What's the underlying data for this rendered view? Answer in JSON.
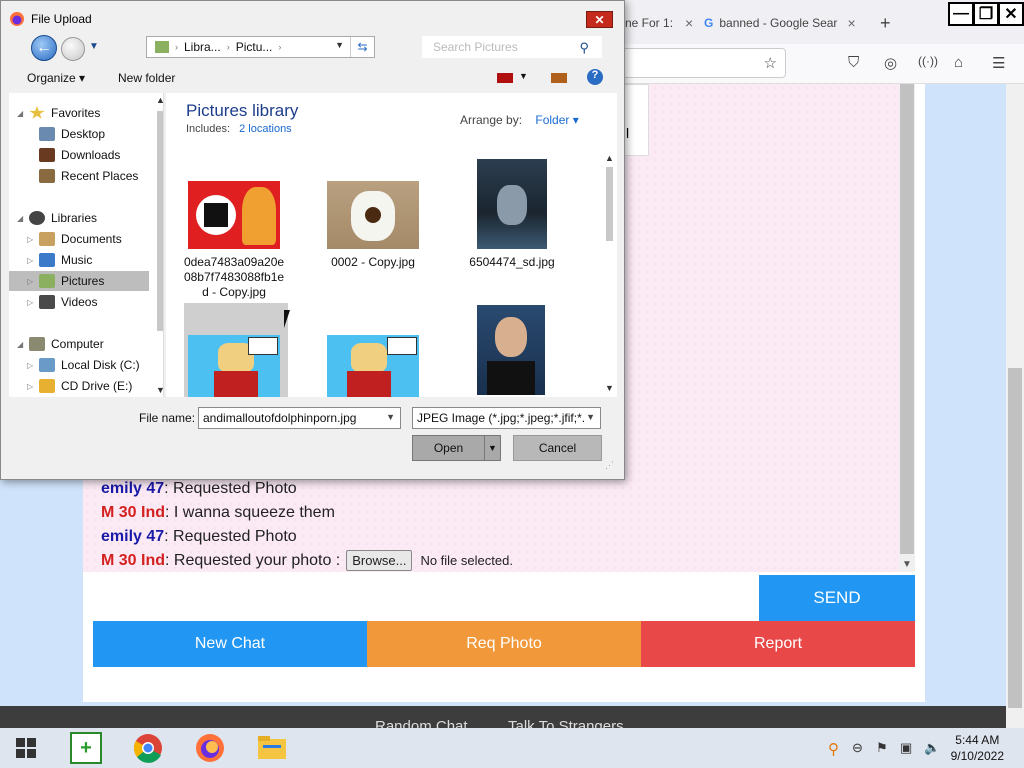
{
  "browser": {
    "tabs": [
      {
        "label": "ne For 1:",
        "close": "×"
      },
      {
        "label": "banned - Google Sear",
        "close": "×"
      }
    ],
    "new_tab": "+"
  },
  "chat": {
    "messages": [
      {
        "user": "emily 47",
        "user_color": "#1a1aa8",
        "text": ": Requested Photo"
      },
      {
        "user": "M 30 Ind",
        "user_color": "#d42020",
        "text": ": I wanna squeeze them"
      },
      {
        "user": "emily 47",
        "user_color": "#1a1aa8",
        "text": ": Requested Photo"
      },
      {
        "user": "M 30 Ind",
        "user_color": "#d42020",
        "text": ": Requested your photo :"
      }
    ],
    "browse_label": "Browse...",
    "no_file": "No file selected.",
    "send_label": "SEND",
    "new_chat_label": "New Chat",
    "req_photo_label": "Req Photo",
    "report_label": "Report",
    "footer_links": [
      "Random Chat",
      "Talk To Strangers"
    ],
    "popup_char": "l"
  },
  "dialog": {
    "title": "File Upload",
    "close": "✕",
    "address_segments": [
      "Libra...",
      "Pictu..."
    ],
    "search_placeholder": "Search Pictures",
    "organize_label": "Organize",
    "new_folder_label": "New folder",
    "tree": {
      "favorites": "Favorites",
      "desktop": "Desktop",
      "downloads": "Downloads",
      "recent": "Recent Places",
      "libraries": "Libraries",
      "documents": "Documents",
      "music": "Music",
      "pictures": "Pictures",
      "videos": "Videos",
      "computer": "Computer",
      "local_disk": "Local Disk (C:)",
      "cd_drive": "CD Drive (E:)"
    },
    "library_title": "Pictures library",
    "includes_label": "Includes:",
    "includes_link": "2 locations",
    "arrange_label": "Arrange by:",
    "arrange_value": "Folder",
    "files": [
      {
        "name": "0dea7483a09a20e08b7f7483088fb1ed - Copy.jpg"
      },
      {
        "name": "0002 - Copy.jpg"
      },
      {
        "name": "6504474_sd.jpg"
      }
    ],
    "file_name_label": "File name:",
    "file_name_value": "andimalloutofdolphinporn.jpg",
    "file_type_value": "JPEG Image (*.jpg;*.jpeg;*.jfif;*.",
    "open_label": "Open",
    "cancel_label": "Cancel"
  },
  "taskbar": {
    "time": "5:44 AM",
    "date": "9/10/2022"
  }
}
